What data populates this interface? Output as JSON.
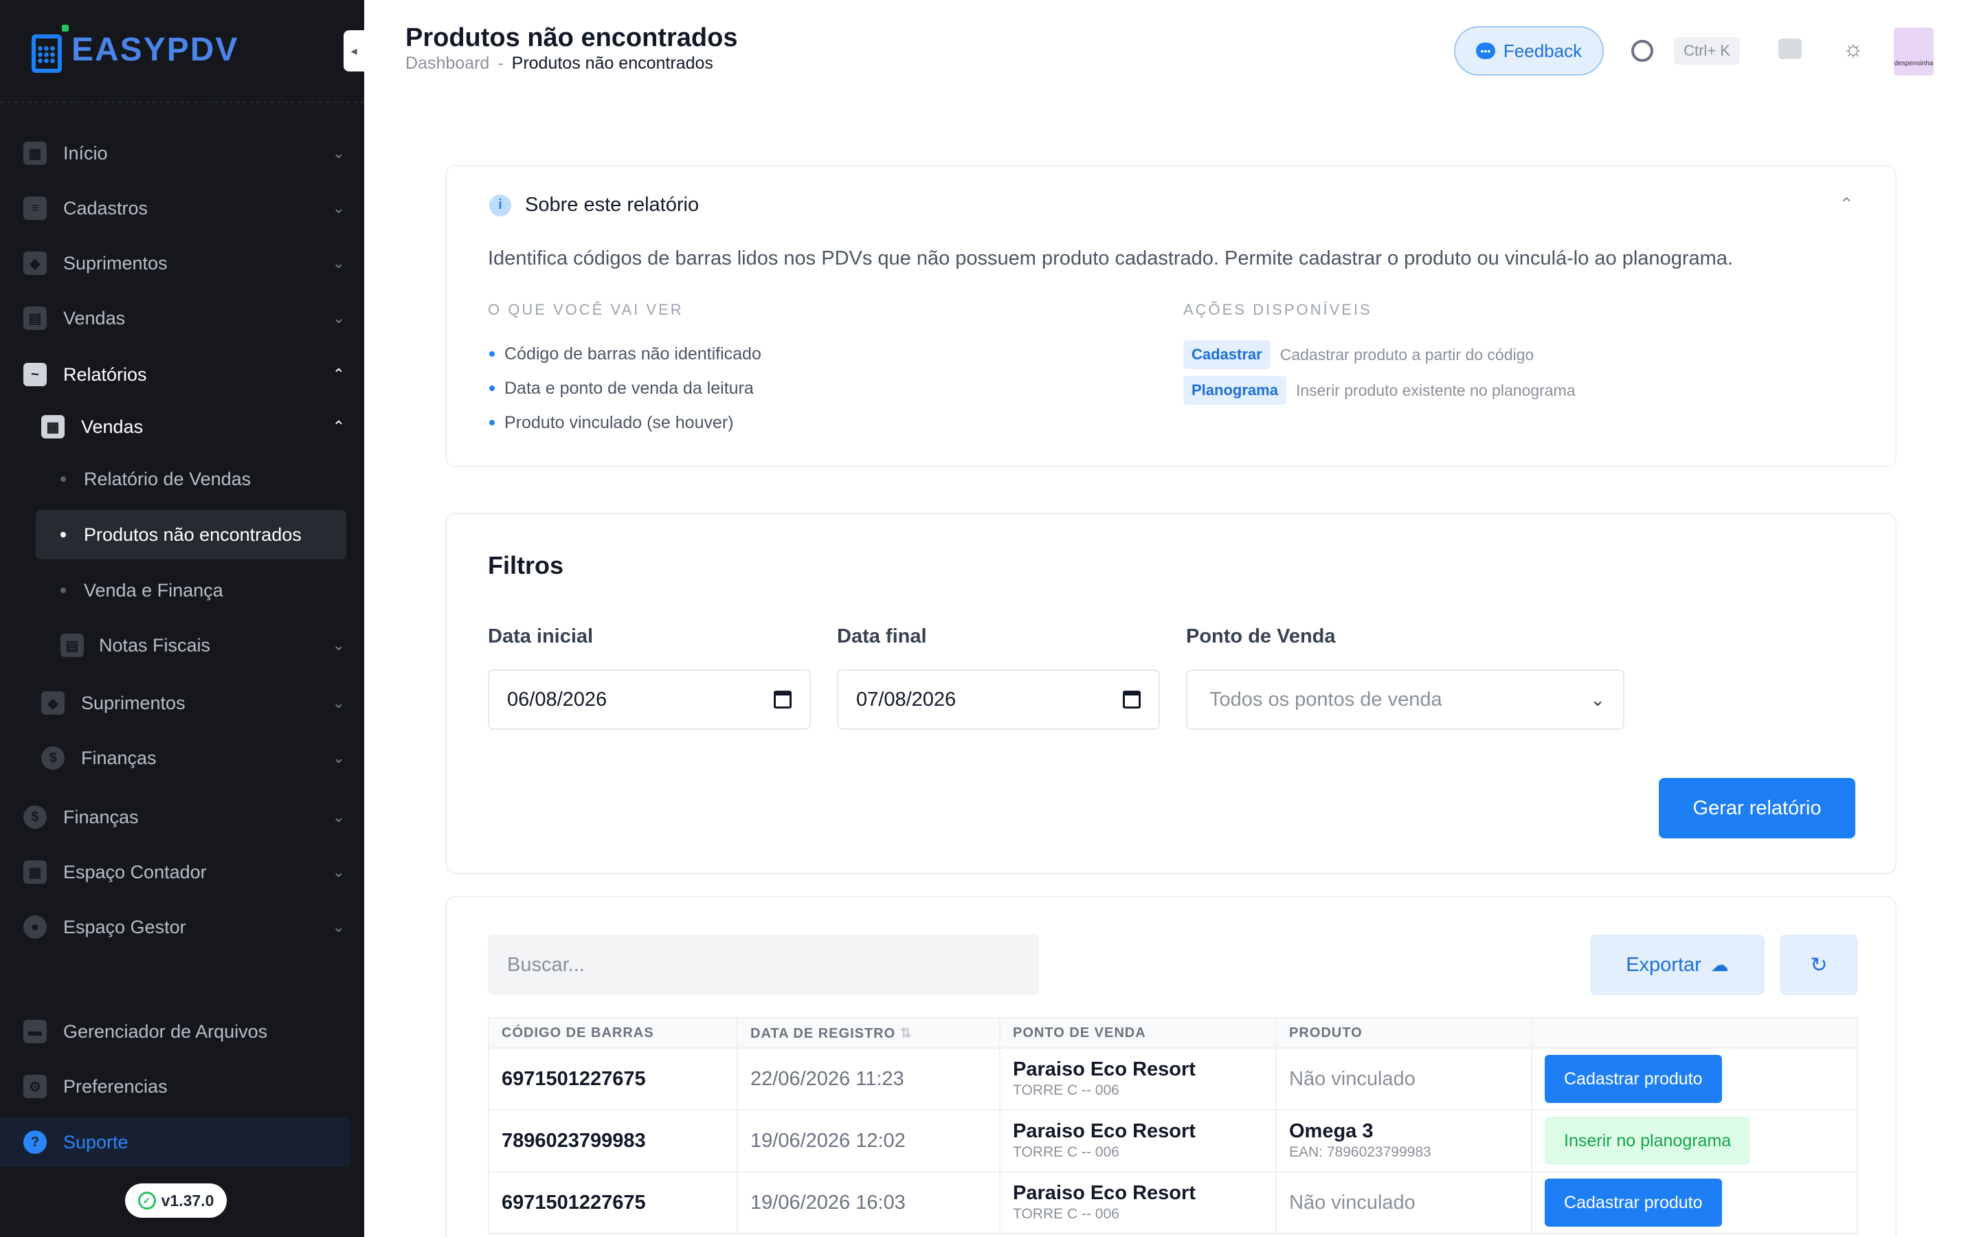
{
  "app": {
    "logo_text_a": "EASY",
    "logo_text_b": "PDV",
    "version": "v1.37.0"
  },
  "sidebar": {
    "items": [
      {
        "label": "Início"
      },
      {
        "label": "Cadastros"
      },
      {
        "label": "Suprimentos"
      },
      {
        "label": "Vendas"
      },
      {
        "label": "Relatórios"
      },
      {
        "label": "Vendas"
      },
      {
        "label": "Relatório de Vendas"
      },
      {
        "label": "Produtos não encontrados"
      },
      {
        "label": "Venda e Finança"
      },
      {
        "label": "Notas Fiscais"
      },
      {
        "label": "Suprimentos"
      },
      {
        "label": "Finanças"
      },
      {
        "label": "Finanças"
      },
      {
        "label": "Espaço Contador"
      },
      {
        "label": "Espaço Gestor"
      },
      {
        "label": "Gerenciador de Arquivos"
      },
      {
        "label": "Preferencias"
      },
      {
        "label": "Suporte"
      }
    ]
  },
  "header": {
    "title": "Produtos não encontrados",
    "breadcrumb": {
      "root": "Dashboard",
      "sep": "-",
      "current": "Produtos não encontrados"
    },
    "feedback_label": "Feedback",
    "shortcut": "Ctrl+ K",
    "avatar_text": "despensinha"
  },
  "about": {
    "title": "Sobre este relatório",
    "description": "Identifica códigos de barras lidos nos PDVs que não possuem produto cadastrado. Permite cadastrar o produto ou vinculá-lo ao planograma.",
    "what_label": "O QUE VOCÊ VAI VER",
    "what_items": [
      "Código de barras não identificado",
      "Data e ponto de venda da leitura",
      "Produto vinculado (se houver)"
    ],
    "actions_label": "AÇÕES DISPONÍVEIS",
    "actions": [
      {
        "tag": "Cadastrar",
        "desc": "Cadastrar produto a partir do código"
      },
      {
        "tag": "Planograma",
        "desc": "Inserir produto existente no planograma"
      }
    ]
  },
  "filters": {
    "title": "Filtros",
    "start_label": "Data inicial",
    "start_value": "06/08/2026",
    "end_label": "Data final",
    "end_value": "07/08/2026",
    "pos_label": "Ponto de Venda",
    "pos_value": "Todos os pontos de venda",
    "generate_label": "Gerar relatório"
  },
  "results": {
    "search_placeholder": "Buscar...",
    "export_label": "Exportar",
    "columns": [
      "CÓDIGO DE BARRAS",
      "DATA DE REGISTRO",
      "PONTO DE VENDA",
      "PRODUTO"
    ],
    "rows": [
      {
        "code": "6971501227675",
        "date": "22/06/2026 11:23",
        "pos": "Paraiso Eco Resort",
        "pos_sub": "TORRE C -- 006",
        "product": "Não vinculado",
        "product_sub": "",
        "action": "Cadastrar produto"
      },
      {
        "code": "7896023799983",
        "date": "19/06/2026 12:02",
        "pos": "Paraiso Eco Resort",
        "pos_sub": "TORRE C -- 006",
        "product": "Omega 3",
        "product_sub": "EAN: 7896023799983",
        "action": "Inserir no planograma"
      },
      {
        "code": "6971501227675",
        "date": "19/06/2026 16:03",
        "pos": "Paraiso Eco Resort",
        "pos_sub": "TORRE C -- 006",
        "product": "Não vinculado",
        "product_sub": "",
        "action": "Cadastrar produto"
      }
    ]
  }
}
